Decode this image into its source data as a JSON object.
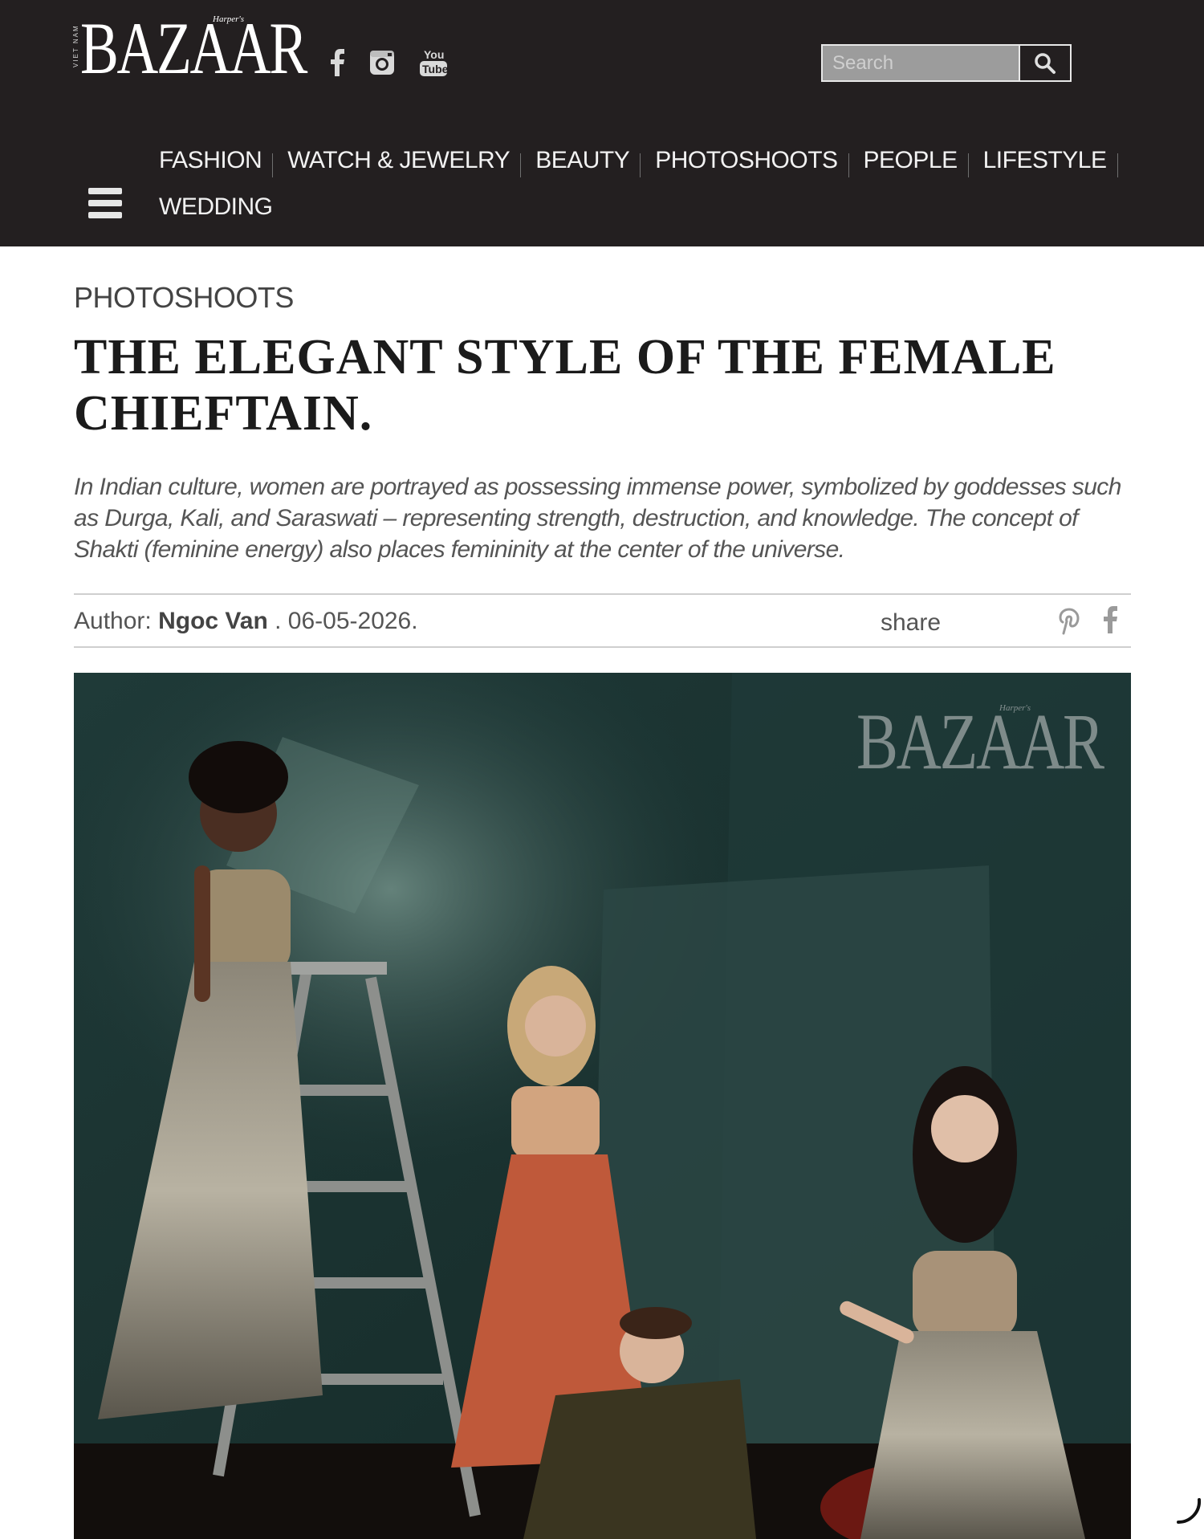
{
  "header": {
    "logo_text": "BAZAAR",
    "logo_small": "Harper's",
    "logo_country": "VIET NAM",
    "social": [
      {
        "name": "facebook-icon"
      },
      {
        "name": "instagram-icon"
      },
      {
        "name": "youtube-icon",
        "text_top": "You",
        "text_bottom": "Tube"
      }
    ],
    "search": {
      "placeholder": "Search"
    },
    "nav": {
      "row1": [
        "FASHION",
        "WATCH & JEWELRY",
        "BEAUTY",
        "PHOTOSHOOTS",
        "PEOPLE",
        "LIFESTYLE"
      ],
      "row2": [
        "WEDDING"
      ]
    }
  },
  "article": {
    "category": "PHOTOSHOOTS",
    "title": "THE ELEGANT STYLE OF THE FEMALE CHIEFTAIN.",
    "lede": "In Indian culture, women are portrayed as possessing immense power, symbolized by goddesses such as Durga, Kali, and Saraswati – representing strength, destruction, and knowledge. The concept of Shakti (feminine energy) also places femininity at the center of the universe.",
    "author_label": "Author:",
    "author_name": "Ngoc Van",
    "date": " . 06-05-2026.",
    "share_label": "share"
  },
  "hero": {
    "watermark": "BAZAAR",
    "watermark_small": "Harper's"
  },
  "colors": {
    "header_bg": "#231f20",
    "nav_text": "#f2f2f2",
    "title_text": "#1b1b1b",
    "hero_bg": "#17302f"
  }
}
